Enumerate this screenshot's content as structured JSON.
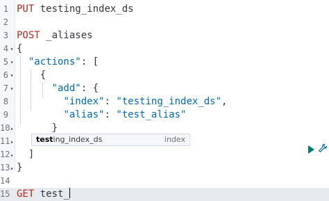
{
  "editor": {
    "lines": [
      {
        "n": "1",
        "fold": "",
        "parts": [
          [
            "kw",
            "PUT"
          ],
          [
            "txt",
            " "
          ],
          [
            "txt",
            "testing_index_ds"
          ]
        ]
      },
      {
        "n": "2",
        "fold": "",
        "parts": []
      },
      {
        "n": "3",
        "fold": "",
        "parts": [
          [
            "kw",
            "POST"
          ],
          [
            "txt",
            " _aliases"
          ]
        ]
      },
      {
        "n": "4",
        "fold": "▾",
        "parts": [
          [
            "punct",
            "{"
          ]
        ]
      },
      {
        "n": "5",
        "fold": "▾",
        "parts": [
          [
            "txt",
            "  "
          ],
          [
            "str",
            "\"actions\""
          ],
          [
            "punct",
            ": ["
          ]
        ]
      },
      {
        "n": "6",
        "fold": "▾",
        "parts": [
          [
            "txt",
            "    "
          ],
          [
            "punct",
            "{"
          ]
        ]
      },
      {
        "n": "7",
        "fold": "▾",
        "parts": [
          [
            "txt",
            "      "
          ],
          [
            "str",
            "\"add\""
          ],
          [
            "punct",
            ": {"
          ]
        ]
      },
      {
        "n": "8",
        "fold": "",
        "parts": [
          [
            "txt",
            "        "
          ],
          [
            "str",
            "\"index\""
          ],
          [
            "punct",
            ": "
          ],
          [
            "str",
            "\"testing_index_ds\""
          ],
          [
            "punct",
            ","
          ]
        ]
      },
      {
        "n": "9",
        "fold": "",
        "parts": [
          [
            "txt",
            "        "
          ],
          [
            "str",
            "\"alias\""
          ],
          [
            "punct",
            ": "
          ],
          [
            "str",
            "\"test_alias\""
          ]
        ]
      },
      {
        "n": "10",
        "fold": "▴",
        "parts": [
          [
            "txt",
            "      "
          ],
          [
            "punct",
            "}"
          ]
        ]
      },
      {
        "n": "11",
        "fold": "▴",
        "parts": [
          [
            "txt",
            "    "
          ],
          [
            "punct",
            "}"
          ]
        ]
      },
      {
        "n": "12",
        "fold": "▴",
        "parts": [
          [
            "txt",
            "  "
          ],
          [
            "punct",
            "]"
          ]
        ]
      },
      {
        "n": "13",
        "fold": "▴",
        "parts": [
          [
            "punct",
            "}"
          ]
        ]
      },
      {
        "n": "14",
        "fold": "",
        "parts": []
      },
      {
        "n": "15",
        "fold": "",
        "parts": [
          [
            "kw",
            "GET"
          ],
          [
            "txt",
            " test_"
          ]
        ]
      }
    ],
    "active_line": 15
  },
  "autocomplete": {
    "typed": "test",
    "rest": "ing_index_ds",
    "meta": "index"
  },
  "icons": {
    "run": "play-icon",
    "settings": "wrench-icon"
  },
  "colors": {
    "keyword": "#bd271e",
    "string": "#006bb4",
    "run_icon": "#017d73"
  }
}
